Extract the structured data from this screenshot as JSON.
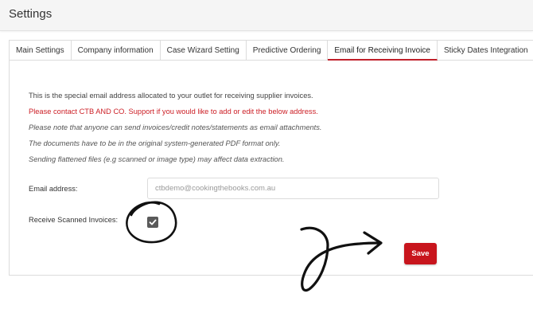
{
  "header": {
    "title": "Settings"
  },
  "tabs": [
    {
      "label": "Main Settings"
    },
    {
      "label": "Company information"
    },
    {
      "label": "Case Wizard Setting"
    },
    {
      "label": "Predictive Ordering"
    },
    {
      "label": "Email for Receiving Invoice",
      "active": true
    },
    {
      "label": "Sticky Dates Integration"
    }
  ],
  "content": {
    "line1": "This is the special email address allocated to your outlet for receiving supplier invoices.",
    "line2": "Please contact CTB AND CO. Support if you would like to add or edit the below address.",
    "line3": "Please note that anyone can send invoices/credit notes/statements as email attachments.",
    "line4": "The documents have to be in the original system-generated PDF format only.",
    "line5": "Sending flattened files (e.g scanned or image type) may affect data extraction."
  },
  "form": {
    "email_label": "Email address:",
    "email_value": "ctbdemo@cookingthebooks.com.au",
    "scanned_label": "Receive Scanned Invoices:",
    "scanned_checked": true,
    "save_label": "Save"
  },
  "colors": {
    "accent": "#c8151d",
    "warning_text": "#cc1e25",
    "checkbox": "#5a5a5a"
  },
  "icons": {
    "checkbox": "check-icon",
    "annotation_circle": "hand-drawn-circle",
    "annotation_arrow": "hand-drawn-arrow"
  }
}
